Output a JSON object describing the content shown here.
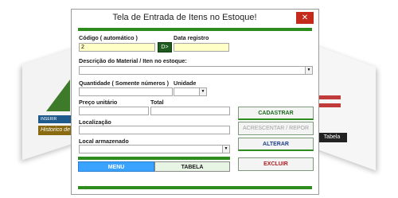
{
  "background": {
    "inserir_label": "INSERIR",
    "historico_label": "Historico de",
    "tabela_label": "Tabela"
  },
  "dialog": {
    "title": "Tela de Entrada de Itens no Estoque!",
    "close_glyph": "✕"
  },
  "form": {
    "codigo_label": "Código ( automático )",
    "codigo_value": "2",
    "data_registro_label": "Data registro",
    "data_registro_value": "",
    "date_button_label": "D>",
    "descricao_label": "Descrição do Material / Iten no estoque:",
    "descricao_value": "",
    "quantidade_label": "Quantidade ( Somente números )",
    "quantidade_value": "",
    "unidade_label": "Unidade",
    "unidade_value": "",
    "preco_label": "Preço unitário",
    "preco_value": "",
    "total_label": "Total",
    "total_value": "",
    "localizacao_label": "Localização",
    "localizacao_value": "",
    "local_armazenado_label": "Local armazenado",
    "local_armazenado_value": "",
    "dropdown_glyph": "▼"
  },
  "actions": {
    "cadastrar": "CADASTRAR",
    "acrescentar": "ACRESCENTAR / REPOR",
    "alterar": "ALTERAR",
    "excluir": "EXCLUIR"
  },
  "nav": {
    "menu": "MENU",
    "tabela": "TABELA"
  },
  "colors": {
    "accent_green": "#2e8b1e",
    "field_yellow": "#ffffc6",
    "menu_blue": "#3aa3ff",
    "close_red": "#c42b1c",
    "cadastrar_color": "#1f6b1f",
    "alterar_color": "#1f3f8c",
    "excluir_color": "#b01e1e"
  }
}
